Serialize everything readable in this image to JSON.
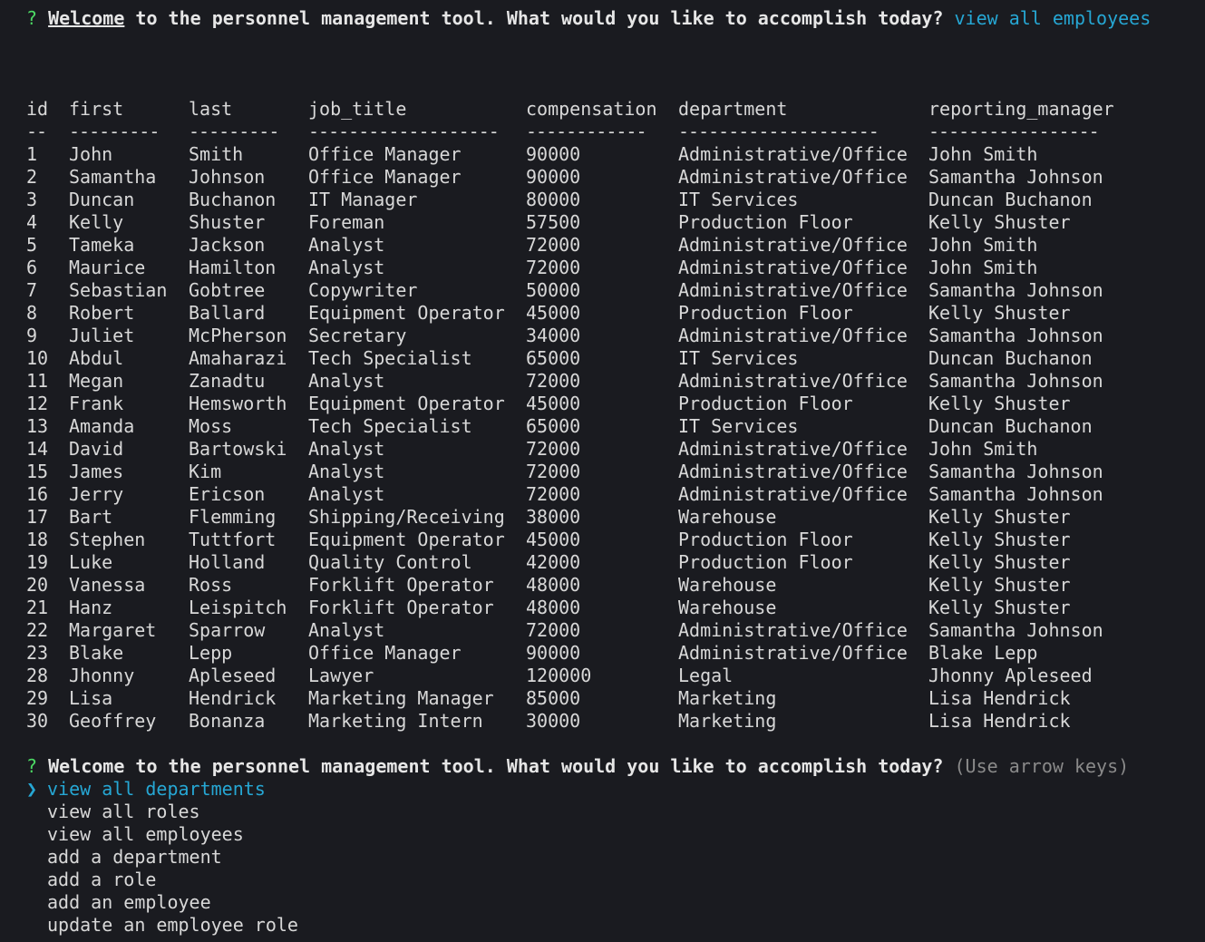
{
  "prompt": {
    "mark": "?",
    "welcome_word": "Welcome",
    "question_rest": " to the personnel management tool. What would you like to accomplish today?",
    "first_answer": "view all employees",
    "question_full": "Welcome to the personnel management tool. What would you like to accomplish today?",
    "hint": "(Use arrow keys)",
    "pointer": "❯"
  },
  "table": {
    "columns": [
      "id",
      "first",
      "last",
      "job_title",
      "compensation",
      "department",
      "reporting_manager"
    ],
    "separators": [
      "--",
      "---------",
      "---------",
      "-------------------",
      "------------",
      "--------------------",
      "-----------------"
    ],
    "rows": [
      [
        "1",
        "John",
        "Smith",
        "Office Manager",
        "90000",
        "Administrative/Office",
        "John Smith"
      ],
      [
        "2",
        "Samantha",
        "Johnson",
        "Office Manager",
        "90000",
        "Administrative/Office",
        "Samantha Johnson"
      ],
      [
        "3",
        "Duncan",
        "Buchanon",
        "IT Manager",
        "80000",
        "IT Services",
        "Duncan Buchanon"
      ],
      [
        "4",
        "Kelly",
        "Shuster",
        "Foreman",
        "57500",
        "Production Floor",
        "Kelly Shuster"
      ],
      [
        "5",
        "Tameka",
        "Jackson",
        "Analyst",
        "72000",
        "Administrative/Office",
        "John Smith"
      ],
      [
        "6",
        "Maurice",
        "Hamilton",
        "Analyst",
        "72000",
        "Administrative/Office",
        "John Smith"
      ],
      [
        "7",
        "Sebastian",
        "Gobtree",
        "Copywriter",
        "50000",
        "Administrative/Office",
        "Samantha Johnson"
      ],
      [
        "8",
        "Robert",
        "Ballard",
        "Equipment Operator",
        "45000",
        "Production Floor",
        "Kelly Shuster"
      ],
      [
        "9",
        "Juliet",
        "McPherson",
        "Secretary",
        "34000",
        "Administrative/Office",
        "Samantha Johnson"
      ],
      [
        "10",
        "Abdul",
        "Amaharazi",
        "Tech Specialist",
        "65000",
        "IT Services",
        "Duncan Buchanon"
      ],
      [
        "11",
        "Megan",
        "Zanadtu",
        "Analyst",
        "72000",
        "Administrative/Office",
        "Samantha Johnson"
      ],
      [
        "12",
        "Frank",
        "Hemsworth",
        "Equipment Operator",
        "45000",
        "Production Floor",
        "Kelly Shuster"
      ],
      [
        "13",
        "Amanda",
        "Moss",
        "Tech Specialist",
        "65000",
        "IT Services",
        "Duncan Buchanon"
      ],
      [
        "14",
        "David",
        "Bartowski",
        "Analyst",
        "72000",
        "Administrative/Office",
        "John Smith"
      ],
      [
        "15",
        "James",
        "Kim",
        "Analyst",
        "72000",
        "Administrative/Office",
        "Samantha Johnson"
      ],
      [
        "16",
        "Jerry",
        "Ericson",
        "Analyst",
        "72000",
        "Administrative/Office",
        "Samantha Johnson"
      ],
      [
        "17",
        "Bart",
        "Flemming",
        "Shipping/Receiving",
        "38000",
        "Warehouse",
        "Kelly Shuster"
      ],
      [
        "18",
        "Stephen",
        "Tuttfort",
        "Equipment Operator",
        "45000",
        "Production Floor",
        "Kelly Shuster"
      ],
      [
        "19",
        "Luke",
        "Holland",
        "Quality Control",
        "42000",
        "Production Floor",
        "Kelly Shuster"
      ],
      [
        "20",
        "Vanessa",
        "Ross",
        "Forklift Operator",
        "48000",
        "Warehouse",
        "Kelly Shuster"
      ],
      [
        "21",
        "Hanz",
        "Leispitch",
        "Forklift Operator",
        "48000",
        "Warehouse",
        "Kelly Shuster"
      ],
      [
        "22",
        "Margaret",
        "Sparrow",
        "Analyst",
        "72000",
        "Administrative/Office",
        "Samantha Johnson"
      ],
      [
        "23",
        "Blake",
        "Lepp",
        "Office Manager",
        "90000",
        "Administrative/Office",
        "Blake Lepp"
      ],
      [
        "28",
        "Jhonny",
        "Apleseed",
        "Lawyer",
        "120000",
        "Legal",
        "Jhonny Apleseed"
      ],
      [
        "29",
        "Lisa",
        "Hendrick",
        "Marketing Manager",
        "85000",
        "Marketing",
        "Lisa Hendrick"
      ],
      [
        "30",
        "Geoffrey",
        "Bonanza",
        "Marketing Intern",
        "30000",
        "Marketing",
        "Lisa Hendrick"
      ]
    ]
  },
  "menu": {
    "items": [
      "view all departments",
      "view all roles",
      "view all employees",
      "add a department",
      "add a role",
      "add an employee",
      "update an employee role"
    ],
    "selected_index": 0
  },
  "colors": {
    "background": "#1a1b20",
    "text": "#d8d8d8",
    "question_mark": "#4cd964",
    "answer": "#26a7d4",
    "hint": "#8a8a8a"
  }
}
